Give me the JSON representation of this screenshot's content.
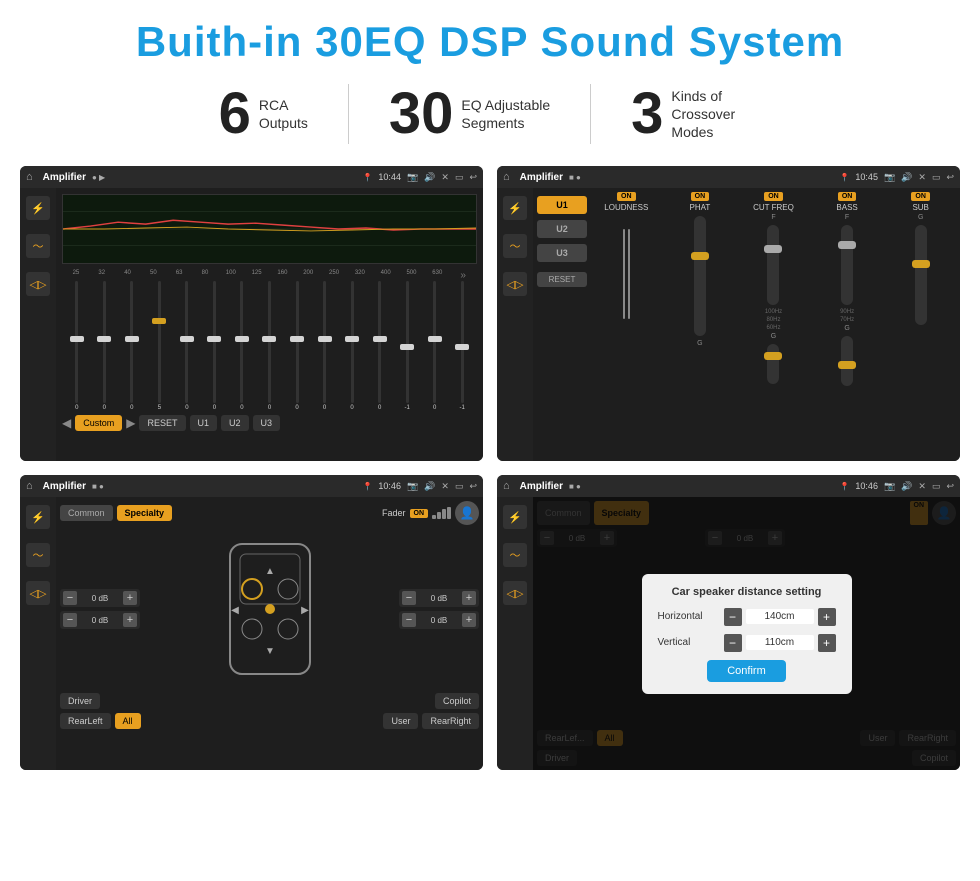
{
  "header": {
    "title": "Buith-in 30EQ DSP Sound System"
  },
  "stats": [
    {
      "number": "6",
      "label_line1": "RCA",
      "label_line2": "Outputs"
    },
    {
      "number": "30",
      "label_line1": "EQ Adjustable",
      "label_line2": "Segments"
    },
    {
      "number": "3",
      "label_line1": "Kinds of",
      "label_line2": "Crossover Modes"
    }
  ],
  "screens": {
    "screen1": {
      "topbar": {
        "title": "Amplifier",
        "time": "10:44"
      },
      "eq_freqs": [
        "25",
        "32",
        "40",
        "50",
        "63",
        "80",
        "100",
        "125",
        "160",
        "200",
        "250",
        "320",
        "400",
        "500",
        "630"
      ],
      "eq_values": [
        "0",
        "0",
        "0",
        "5",
        "0",
        "0",
        "0",
        "0",
        "0",
        "0",
        "0",
        "0",
        "-1",
        "0",
        "-1"
      ],
      "bottom_buttons": [
        "Custom",
        "RESET",
        "U1",
        "U2",
        "U3"
      ]
    },
    "screen2": {
      "topbar": {
        "title": "Amplifier",
        "time": "10:45"
      },
      "presets": [
        "U1",
        "U2",
        "U3"
      ],
      "controls": [
        "LOUDNESS",
        "PHAT",
        "CUT FREQ",
        "BASS",
        "SUB"
      ],
      "reset_label": "RESET"
    },
    "screen3": {
      "topbar": {
        "title": "Amplifier",
        "time": "10:46"
      },
      "tabs": [
        "Common",
        "Specialty"
      ],
      "fader_label": "Fader",
      "volumes": [
        "0 dB",
        "0 dB",
        "0 dB",
        "0 dB"
      ],
      "bottom_buttons": [
        "Driver",
        "Copilot",
        "RearLeft",
        "All",
        "User",
        "RearRight"
      ]
    },
    "screen4": {
      "topbar": {
        "title": "Amplifier",
        "time": "10:46"
      },
      "tabs": [
        "Common",
        "Specialty"
      ],
      "dialog": {
        "title": "Car speaker distance setting",
        "horizontal_label": "Horizontal",
        "horizontal_value": "140cm",
        "vertical_label": "Vertical",
        "vertical_value": "110cm",
        "confirm_label": "Confirm"
      },
      "volumes_right": [
        "0 dB",
        "0 dB"
      ],
      "bottom_buttons": [
        "Driver",
        "Copilot",
        "RearLeft",
        "All",
        "User",
        "RearRight"
      ]
    }
  }
}
